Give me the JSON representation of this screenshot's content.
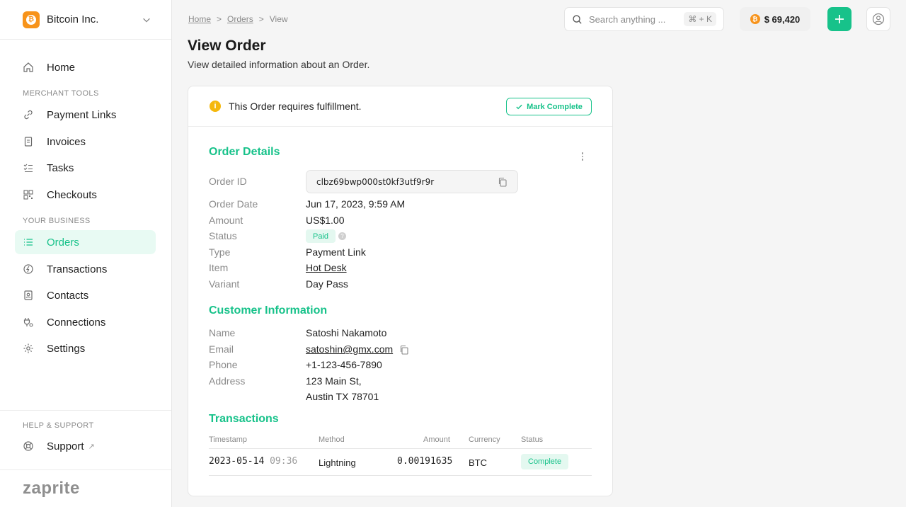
{
  "org": {
    "name": "Bitcoin Inc.",
    "logo_glyph": "₿"
  },
  "sidebar": {
    "home": "Home",
    "section_merchant": "Merchant Tools",
    "merchant_items": [
      "Payment Links",
      "Invoices",
      "Tasks",
      "Checkouts"
    ],
    "section_business": "Your Business",
    "business_items": [
      "Orders",
      "Transactions",
      "Contacts",
      "Connections",
      "Settings"
    ],
    "section_help": "Help & Support",
    "support": "Support",
    "support_ext": "↗",
    "brand": "zaprite"
  },
  "breadcrumb": {
    "home": "Home",
    "orders": "Orders",
    "current": "View",
    "separator": ">"
  },
  "search": {
    "placeholder": "Search anything ...",
    "shortcut": "⌘ + K"
  },
  "balance": {
    "value": "$ 69,420",
    "glyph": "₿"
  },
  "page": {
    "title": "View Order",
    "subtitle": "View detailed information about an Order."
  },
  "alert": {
    "icon": "i",
    "text": "This Order requires fulfillment.",
    "button": "Mark Complete"
  },
  "order_details": {
    "title": "Order Details",
    "id_label": "Order ID",
    "id_value": "clbz69bwp000st0kf3utf9r9r",
    "date_label": "Order Date",
    "date_value": "Jun 17, 2023, 9:59 AM",
    "amount_label": "Amount",
    "amount_value": "US$1.00",
    "status_label": "Status",
    "status_value": "Paid",
    "status_help": "?",
    "type_label": "Type",
    "type_value": "Payment Link",
    "item_label": "Item",
    "item_value": "Hot Desk",
    "variant_label": "Variant",
    "variant_value": "Day Pass"
  },
  "customer": {
    "title": "Customer Information",
    "name_label": "Name",
    "name_value": "Satoshi Nakamoto",
    "email_label": "Email",
    "email_value": "satoshin@gmx.com",
    "phone_label": "Phone",
    "phone_value": "+1-123-456-7890",
    "address_label": "Address",
    "address_line1": "123 Main St,",
    "address_line2": "Austin TX 78701"
  },
  "transactions": {
    "title": "Transactions",
    "headers": {
      "timestamp": "Timestamp",
      "method": "Method",
      "amount": "Amount",
      "currency": "Currency",
      "status": "Status"
    },
    "rows": [
      {
        "date": "2023-05-14",
        "time": "09:36",
        "method": "Lightning",
        "amount": "0.00191635",
        "currency": "BTC",
        "status": "Complete"
      }
    ]
  },
  "colors": {
    "accent": "#17c28a",
    "bitcoin": "#f7931a",
    "warning": "#f5b80c"
  }
}
